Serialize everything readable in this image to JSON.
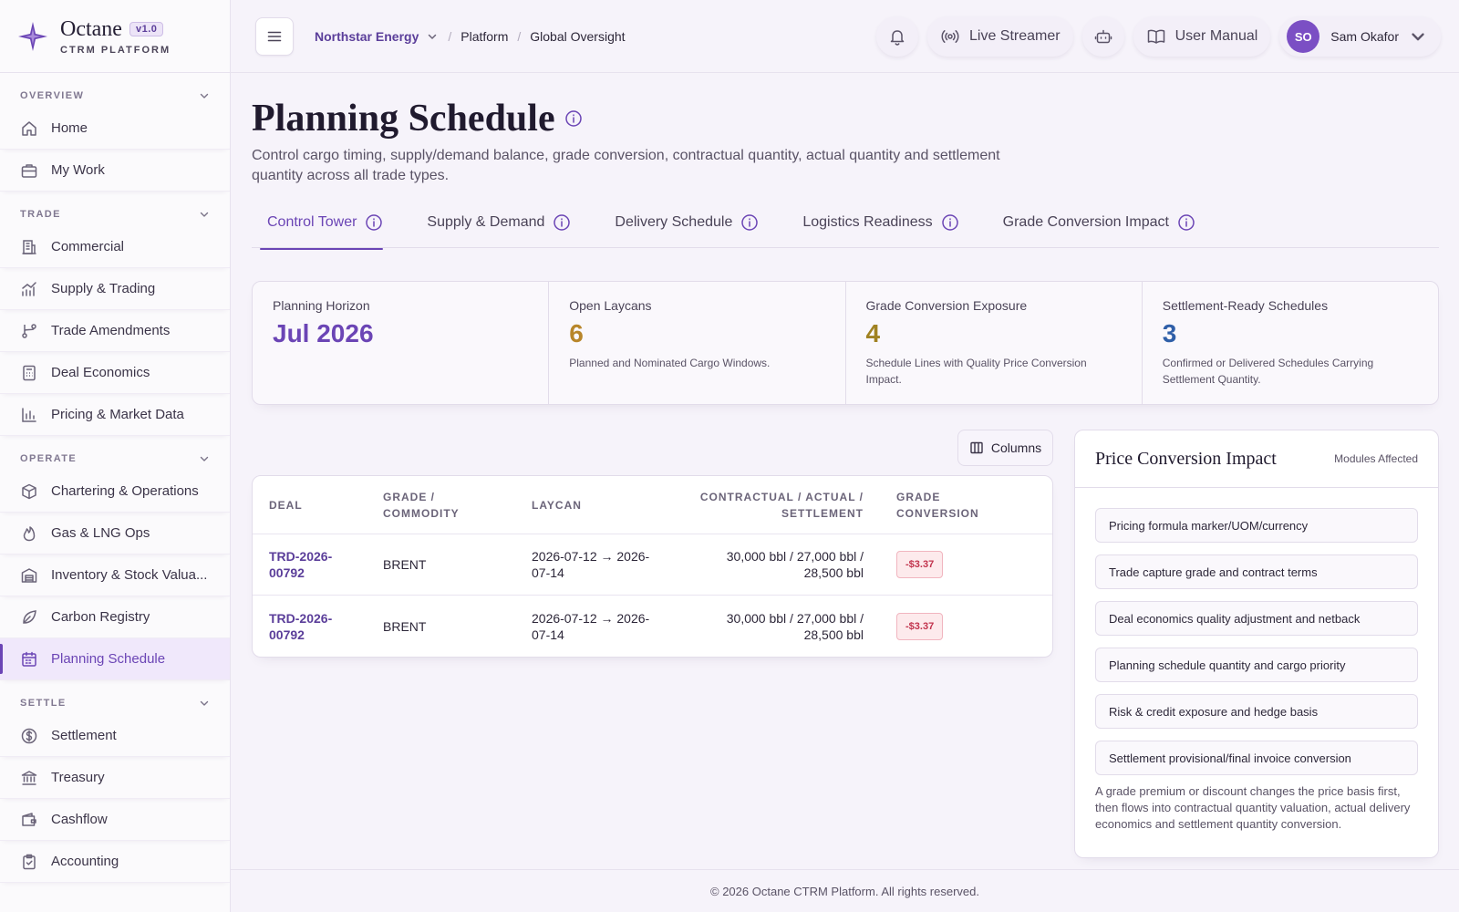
{
  "brand": {
    "name": "Octane",
    "version": "v1.0",
    "subtitle": "CTRM PLATFORM"
  },
  "sidebar": {
    "sections": [
      {
        "label": "OVERVIEW",
        "items": [
          {
            "label": "Home",
            "icon": "home-icon"
          },
          {
            "label": "My Work",
            "icon": "briefcase-icon"
          }
        ]
      },
      {
        "label": "TRADE",
        "items": [
          {
            "label": "Commercial",
            "icon": "building-icon"
          },
          {
            "label": "Supply & Trading",
            "icon": "trending-chart-icon"
          },
          {
            "label": "Trade Amendments",
            "icon": "git-branch-icon"
          },
          {
            "label": "Deal Economics",
            "icon": "calculator-icon"
          },
          {
            "label": "Pricing & Market Data",
            "icon": "bar-chart-icon"
          }
        ]
      },
      {
        "label": "OPERATE",
        "items": [
          {
            "label": "Chartering & Operations",
            "icon": "package-icon"
          },
          {
            "label": "Gas & LNG Ops",
            "icon": "flame-icon"
          },
          {
            "label": "Inventory & Stock Valua...",
            "icon": "warehouse-icon"
          },
          {
            "label": "Carbon Registry",
            "icon": "leaf-icon"
          },
          {
            "label": "Planning Schedule",
            "icon": "calendar-icon",
            "active": true
          }
        ]
      },
      {
        "label": "SETTLE",
        "items": [
          {
            "label": "Settlement",
            "icon": "dollar-circle-icon"
          },
          {
            "label": "Treasury",
            "icon": "bank-icon"
          },
          {
            "label": "Cashflow",
            "icon": "wallet-icon"
          },
          {
            "label": "Accounting",
            "icon": "clipboard-check-icon"
          }
        ]
      }
    ]
  },
  "topbar": {
    "organization": "Northstar Energy",
    "breadcrumbs": [
      "Platform",
      "Global Oversight"
    ],
    "live_streamer_label": "Live Streamer",
    "user_manual_label": "User Manual",
    "user_initials": "SO",
    "user_name": "Sam Okafor"
  },
  "page": {
    "title": "Planning Schedule",
    "description": "Control cargo timing, supply/demand balance, grade conversion, contractual quantity, actual quantity and settlement quantity across all trade types."
  },
  "tabs": [
    {
      "label": "Control Tower",
      "active": true
    },
    {
      "label": "Supply & Demand"
    },
    {
      "label": "Delivery Schedule"
    },
    {
      "label": "Logistics Readiness"
    },
    {
      "label": "Grade Conversion Impact"
    }
  ],
  "kpis": [
    {
      "label": "Planning Horizon",
      "value": "Jul 2026",
      "desc": "",
      "color": "#6b45b5"
    },
    {
      "label": "Open Laycans",
      "value": "6",
      "desc": "Planned and Nominated Cargo Windows.",
      "color": "#b8862a"
    },
    {
      "label": "Grade Conversion Exposure",
      "value": "4",
      "desc": "Schedule Lines with Quality Price Conversion Impact.",
      "color": "#a08222"
    },
    {
      "label": "Settlement-Ready Schedules",
      "value": "3",
      "desc": "Confirmed or Delivered Schedules Carrying Settlement Quantity.",
      "color": "#2f5fa8"
    }
  ],
  "table": {
    "columns_button": "Columns",
    "headers": [
      "DEAL",
      "GRADE / COMMODITY",
      "LAYCAN",
      "CONTRACTUAL / ACTUAL / SETTLEMENT",
      "GRADE CONVERSION"
    ],
    "rows": [
      {
        "deal": "TRD-2026-00792",
        "grade": "BRENT",
        "laycan": "2026-07-12 → 2026-07-14",
        "quantities": "30,000 bbl / 27,000 bbl / 28,500 bbl",
        "conversion": "-$3.37"
      },
      {
        "deal": "TRD-2026-00792",
        "grade": "BRENT",
        "laycan": "2026-07-12 → 2026-07-14",
        "quantities": "30,000 bbl / 27,000 bbl / 28,500 bbl",
        "conversion": "-$3.37"
      }
    ]
  },
  "impact_panel": {
    "title": "Price Conversion Impact",
    "aside": "Modules Affected",
    "items": [
      "Pricing formula marker/UOM/currency",
      "Trade capture grade and contract terms",
      "Deal economics quality adjustment and netback",
      "Planning schedule quantity and cargo priority",
      "Risk & credit exposure and hedge basis",
      "Settlement provisional/final invoice conversion"
    ],
    "note": "A grade premium or discount changes the price basis first, then flows into contractual quantity valuation, actual delivery economics and settlement quantity conversion."
  },
  "footer": {
    "text": "© 2026 Octane CTRM Platform. All rights reserved."
  },
  "colors": {
    "accent": "#6b45b5",
    "negative": "#c2334d"
  }
}
